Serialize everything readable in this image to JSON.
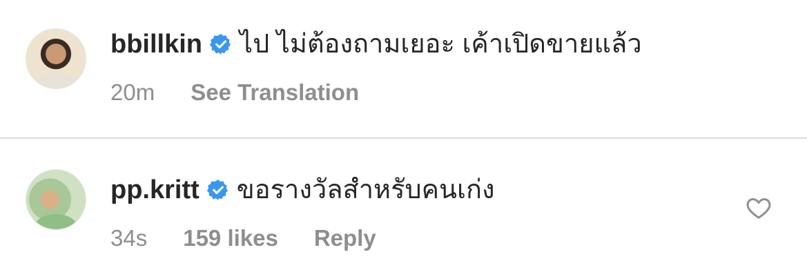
{
  "comments": [
    {
      "username": "bbillkin",
      "text": "ไป ไม่ต้องถามเยอะ เค้าเปิดขายแล้ว",
      "time": "20m",
      "action": "See Translation"
    },
    {
      "username": "pp.kritt",
      "text": "ขอรางวัลสำหรับคนเก่ง",
      "time": "34s",
      "likes": "159 likes",
      "reply": "Reply"
    }
  ],
  "colors": {
    "text": "#262626",
    "meta": "#8e8e8e",
    "verified": "#3897f0",
    "divider": "#dbdbdb"
  },
  "icons": [
    "verified-badge-icon",
    "heart-icon"
  ]
}
